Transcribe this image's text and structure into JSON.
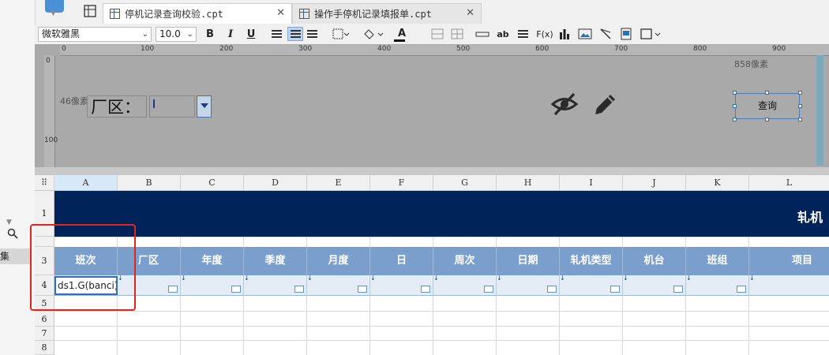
{
  "tabs": [
    {
      "label": "停机记录查询校验.cpt",
      "active": true
    },
    {
      "label": "操作手停机记录填报单.cpt",
      "active": false
    }
  ],
  "toolbar": {
    "font_name": "微软雅黑",
    "font_size": "10.0",
    "bold": "B",
    "italic": "I",
    "underline": "U",
    "text_tool": "ab",
    "formula_tool": "F(x)",
    "font_color_label": "A"
  },
  "ruler": {
    "h_ticks": [
      "0",
      "100",
      "200",
      "300",
      "400",
      "500",
      "600",
      "700",
      "800",
      "900"
    ],
    "v_ticks": [
      "0",
      "100"
    ]
  },
  "design": {
    "width_hint": "858像素",
    "height_hint": "46像素",
    "factory_label": "厂区：",
    "query_button": "查询"
  },
  "sheet": {
    "columns": [
      "A",
      "B",
      "C",
      "D",
      "E",
      "F",
      "G",
      "H",
      "I",
      "J",
      "K",
      "L"
    ],
    "rows": [
      "1",
      "3",
      "4",
      "5",
      "6",
      "7",
      "8"
    ],
    "title_partial": "轧机",
    "headers": [
      "班次",
      "厂区",
      "年度",
      "季度",
      "月度",
      "日",
      "周次",
      "日期",
      "轧机类型",
      "机台",
      "班组",
      "项目"
    ],
    "cell_a4": "ds1.G(banci)"
  },
  "left_panel": {
    "label": "集"
  }
}
